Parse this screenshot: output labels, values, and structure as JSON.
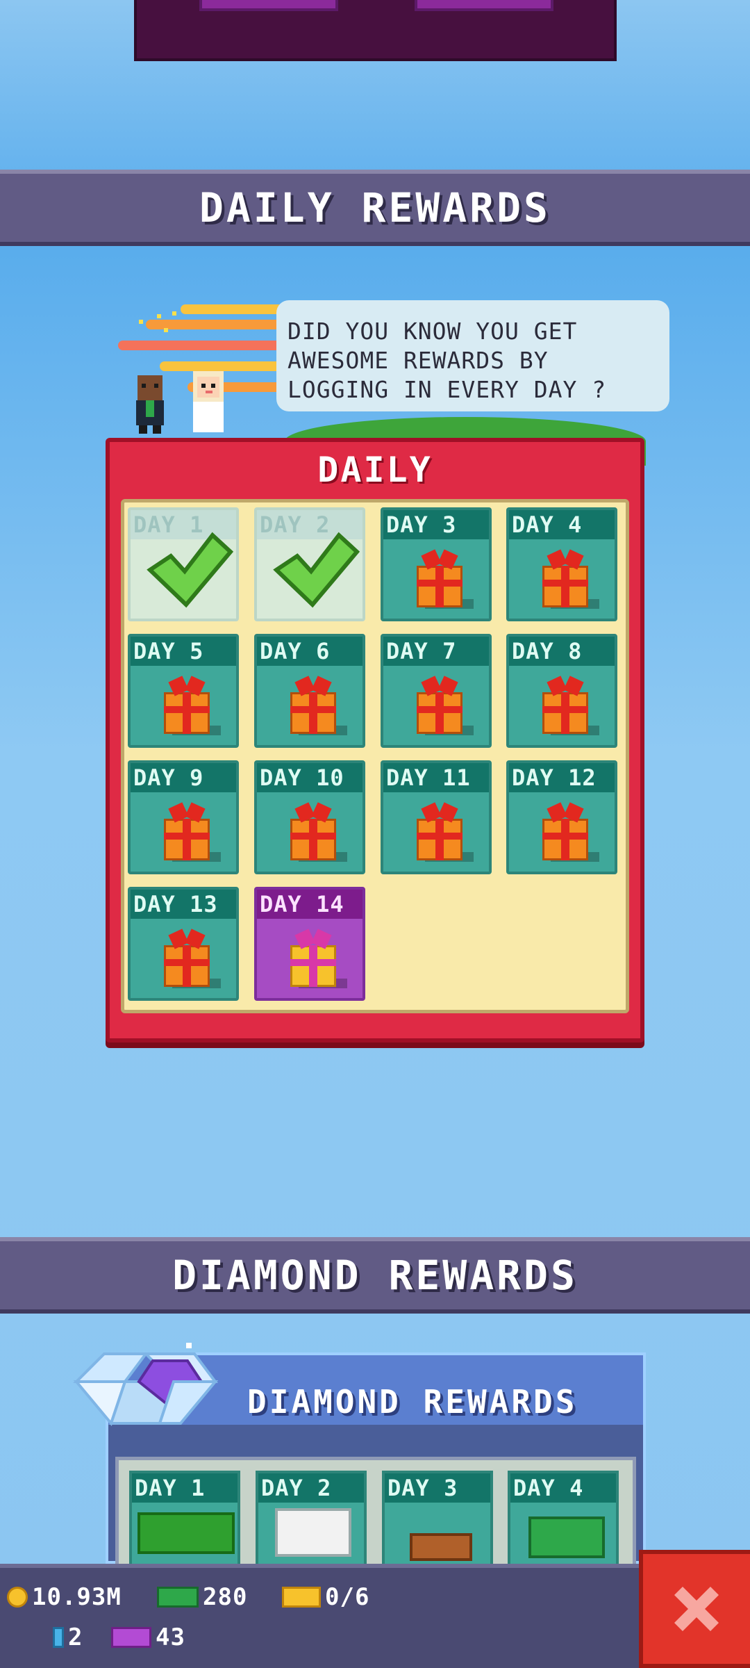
{
  "sections": {
    "daily_banner": "DAILY REWARDS",
    "diamond_banner": "DIAMOND REWARDS"
  },
  "tip": {
    "text": "DID YOU KNOW YOU GET AWESOME REWARDS BY LOGGING IN EVERY DAY ?"
  },
  "daily": {
    "title": "DAILY",
    "days": [
      {
        "label": "DAY 1",
        "state": "claimed"
      },
      {
        "label": "DAY 2",
        "state": "claimed"
      },
      {
        "label": "DAY 3",
        "state": "available"
      },
      {
        "label": "DAY 4",
        "state": "available"
      },
      {
        "label": "DAY 5",
        "state": "available"
      },
      {
        "label": "DAY 6",
        "state": "available"
      },
      {
        "label": "DAY 7",
        "state": "available"
      },
      {
        "label": "DAY 8",
        "state": "available"
      },
      {
        "label": "DAY 9",
        "state": "available"
      },
      {
        "label": "DAY 10",
        "state": "available"
      },
      {
        "label": "DAY 11",
        "state": "available"
      },
      {
        "label": "DAY 12",
        "state": "available"
      },
      {
        "label": "DAY 13",
        "state": "available"
      },
      {
        "label": "DAY 14",
        "state": "special"
      }
    ]
  },
  "diamond": {
    "title": "DIAMOND REWARDS",
    "days": [
      {
        "label": "DAY 1"
      },
      {
        "label": "DAY 2"
      },
      {
        "label": "DAY 3"
      },
      {
        "label": "DAY 4"
      }
    ]
  },
  "resources": {
    "coins": "10.93M",
    "cash": "280",
    "tickets": "0/6",
    "gems": "2",
    "boxes": "43"
  },
  "colors": {
    "banner": "#615b85",
    "daily_frame": "#df2a45",
    "cell": "#3fa89a",
    "special_cell": "#a64cc3",
    "close_button": "#e2342a"
  }
}
